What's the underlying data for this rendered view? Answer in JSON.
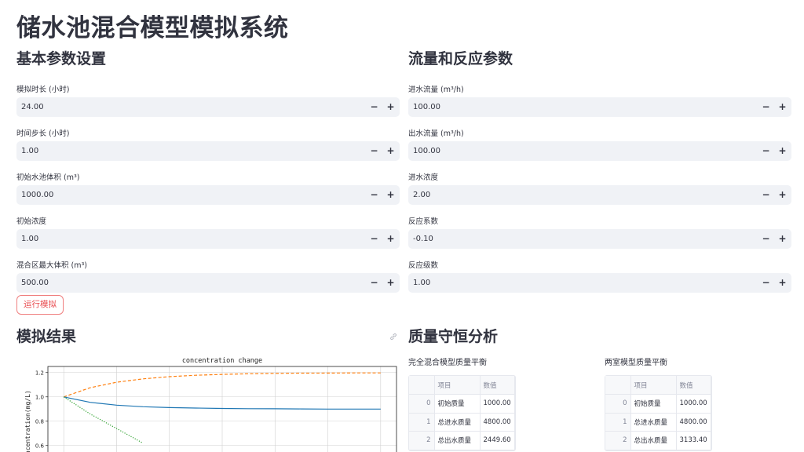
{
  "app_title": "储水池混合模型模拟系统",
  "left_section": {
    "title": "基本参数设置",
    "fields": [
      {
        "label": "模拟时长 (小时)",
        "value": "24.00"
      },
      {
        "label": "时间步长 (小时)",
        "value": "1.00"
      },
      {
        "label": "初始水池体积 (m³)",
        "value": "1000.00"
      },
      {
        "label": "初始浓度",
        "value": "1.00"
      },
      {
        "label": "混合区最大体积 (m³)",
        "value": "500.00"
      }
    ]
  },
  "right_section": {
    "title": "流量和反应参数",
    "fields": [
      {
        "label": "进水流量 (m³/h)",
        "value": "100.00"
      },
      {
        "label": "出水流量 (m³/h)",
        "value": "100.00"
      },
      {
        "label": "进水浓度",
        "value": "2.00"
      },
      {
        "label": "反应系数",
        "value": "-0.10"
      },
      {
        "label": "反应级数",
        "value": "1.00"
      }
    ]
  },
  "stepper": {
    "minus": "−",
    "plus": "+"
  },
  "run_button": "运行模拟",
  "results_title": "模拟结果",
  "mass_title": "质量守恒分析",
  "table1": {
    "caption": "完全混合模型质量平衡",
    "headers": [
      "",
      "项目",
      "数值"
    ],
    "rows": [
      [
        "0",
        "初始质量",
        "1000.00"
      ],
      [
        "1",
        "总进水质量",
        "4800.00"
      ],
      [
        "2",
        "总出水质量",
        "2449.60"
      ]
    ]
  },
  "table2": {
    "caption": "两室模型质量平衡",
    "headers": [
      "",
      "项目",
      "数值"
    ],
    "rows": [
      [
        "0",
        "初始质量",
        "1000.00"
      ],
      [
        "1",
        "总进水质量",
        "4800.00"
      ],
      [
        "2",
        "总出水质量",
        "3133.40"
      ]
    ]
  },
  "chart_data": {
    "type": "line",
    "title": "concentration change",
    "ylabel": "concentration(mg/L)",
    "yticks": [
      "1.2",
      "1.0",
      "0.8",
      "0.6"
    ],
    "ylim": [
      0.55,
      1.25
    ],
    "xlim": [
      -1.2,
      25.2
    ],
    "series": [
      {
        "style": "dashed",
        "color": "#ff7f0e",
        "x": [
          0,
          2,
          4,
          6,
          8,
          10,
          12,
          14,
          16,
          18,
          20,
          22,
          24
        ],
        "y": [
          1.0,
          1.075,
          1.12,
          1.148,
          1.166,
          1.178,
          1.185,
          1.19,
          1.193,
          1.195,
          1.196,
          1.197,
          1.197
        ]
      },
      {
        "style": "solid",
        "color": "#1f77b4",
        "x": [
          0,
          2,
          4,
          6,
          8,
          10,
          12,
          14,
          16,
          18,
          20,
          22,
          24
        ],
        "y": [
          1.0,
          0.955,
          0.932,
          0.919,
          0.912,
          0.908,
          0.905,
          0.903,
          0.902,
          0.901,
          0.9,
          0.9,
          0.9
        ]
      },
      {
        "style": "dotted",
        "color": "#2ca02c",
        "x": [
          0,
          1,
          2,
          3,
          4,
          5,
          6
        ],
        "y": [
          1.0,
          0.93,
          0.86,
          0.8,
          0.74,
          0.68,
          0.62
        ]
      }
    ]
  }
}
